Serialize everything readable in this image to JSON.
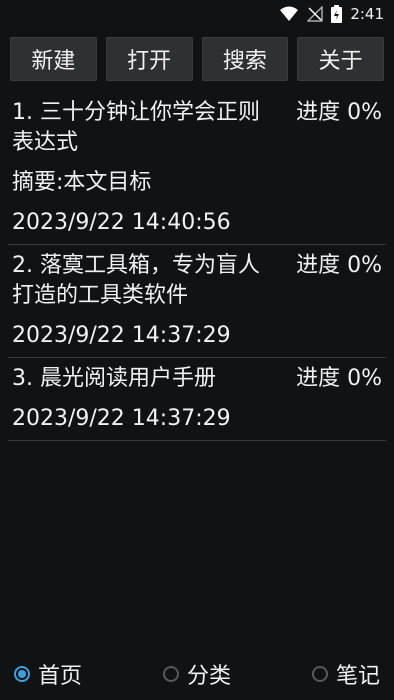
{
  "status": {
    "time": "2:41"
  },
  "toolbar": {
    "new_label": "新建",
    "open_label": "打开",
    "search_label": "搜索",
    "about_label": "关于"
  },
  "documents": [
    {
      "title": "1. 三十分钟让你学会正则表达式",
      "progress": "进度 0%",
      "summary": "摘要:本文目标",
      "date": "2023/9/22 14:40:56"
    },
    {
      "title": "2. 落寞工具箱，专为盲人打造的工具类软件",
      "progress": "进度 0%",
      "date": "2023/9/22 14:37:29"
    },
    {
      "title": "3. 晨光阅读用户手册",
      "progress": "进度 0%",
      "date": "2023/9/22 14:37:29"
    }
  ],
  "nav": {
    "home": "首页",
    "category": "分类",
    "notes": "笔记",
    "selected": "首页"
  },
  "colors": {
    "background": "#101214",
    "button": "#2e3133",
    "accent": "#3da0e0"
  }
}
